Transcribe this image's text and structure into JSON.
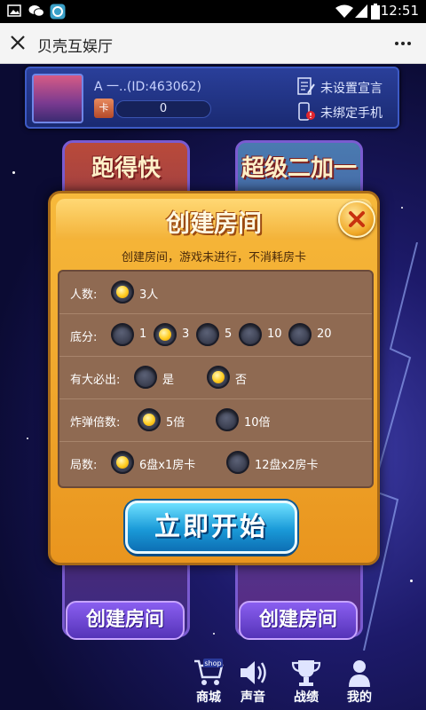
{
  "status_bar": {
    "time": "12:51",
    "icons": [
      "image-icon",
      "wechat-icon",
      "app-icon",
      "wifi-icon",
      "signal-icon",
      "battery-icon"
    ]
  },
  "app_bar": {
    "title": "贝壳互娱厅",
    "close_icon": "close-icon",
    "more_icon": "more-icon"
  },
  "user": {
    "name_id": "A   一..(ID:463062)",
    "card_label": "卡",
    "card_count": "0",
    "links": {
      "declaration": "未设置宣言",
      "phone": "未绑定手机"
    }
  },
  "games": [
    {
      "title": "跑得快",
      "create_label": "创建房间"
    },
    {
      "title": "超级二加一",
      "create_label": "创建房间"
    }
  ],
  "modal": {
    "title": "创建房间",
    "notice": "创建房间，游戏未进行，不消耗房卡",
    "rows": [
      {
        "label": "人数:",
        "options": [
          {
            "text": "3人",
            "selected": true
          }
        ]
      },
      {
        "label": "底分:",
        "options": [
          {
            "text": "1",
            "selected": false
          },
          {
            "text": "3",
            "selected": true
          },
          {
            "text": "5",
            "selected": false
          },
          {
            "text": "10",
            "selected": false
          },
          {
            "text": "20",
            "selected": false
          }
        ]
      },
      {
        "label": "有大必出:",
        "options": [
          {
            "text": "是",
            "selected": false
          },
          {
            "text": "否",
            "selected": true
          }
        ]
      },
      {
        "label": "炸弹倍数:",
        "options": [
          {
            "text": "5倍",
            "selected": true
          },
          {
            "text": "10倍",
            "selected": false
          }
        ]
      },
      {
        "label": "局数:",
        "options": [
          {
            "text": "6盘x1房卡",
            "selected": true
          },
          {
            "text": "12盘x2房卡",
            "selected": false
          }
        ]
      }
    ],
    "start_label": "立即开始"
  },
  "nav": [
    {
      "label": "商城",
      "icon": "shop-cart-icon",
      "badge": "shop"
    },
    {
      "label": "声音",
      "icon": "speaker-icon"
    },
    {
      "label": "战绩",
      "icon": "trophy-icon"
    },
    {
      "label": "我的",
      "icon": "person-icon"
    }
  ],
  "colors": {
    "modal_orange": "#f3a92e",
    "options_brown": "#8f6a52",
    "start_blue": "#1a9ad8",
    "create_purple": "#6a45d0"
  }
}
